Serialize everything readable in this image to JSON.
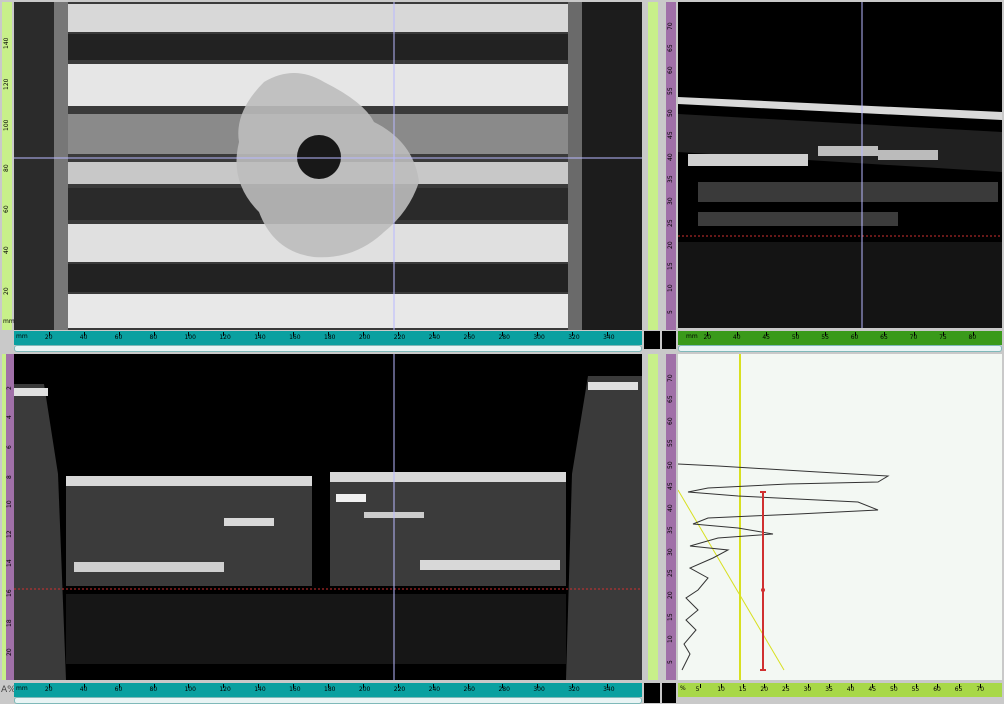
{
  "cscan": {
    "y_axis_label": "mm",
    "x_axis_label": "mm",
    "y_ticks": [
      "20",
      "40",
      "60",
      "80",
      "100",
      "120",
      "140"
    ],
    "x_ticks": [
      "20",
      "40",
      "60",
      "80",
      "100",
      "120",
      "140",
      "160",
      "180",
      "200",
      "220",
      "240",
      "260",
      "280",
      "300",
      "320",
      "340"
    ]
  },
  "sscan": {
    "y_ticks": [
      "2",
      "4",
      "6",
      "8",
      "10",
      "12",
      "14",
      "16",
      "18",
      "20"
    ],
    "y_unit": "mm",
    "x_ticks": [
      "20",
      "40",
      "60",
      "80",
      "100",
      "120",
      "140",
      "160",
      "180",
      "200",
      "220",
      "240",
      "260",
      "280",
      "300",
      "320",
      "340"
    ],
    "x_unit": "mm",
    "corner_label": "A%"
  },
  "bscan": {
    "x_ticks": [
      "20",
      "40",
      "45",
      "50",
      "55",
      "60",
      "65",
      "70",
      "75",
      "80"
    ],
    "x_unit": "mm"
  },
  "ascan": {
    "x_ticks": [
      "5",
      "10",
      "15",
      "20",
      "25",
      "30",
      "35",
      "40",
      "45",
      "50",
      "55",
      "60",
      "65",
      "70"
    ],
    "x_unit": "%"
  },
  "depth_gates": {
    "ticks": [
      "5",
      "10",
      "15",
      "20",
      "25",
      "30",
      "35",
      "40",
      "45",
      "50",
      "55",
      "60",
      "65",
      "70"
    ],
    "unit": "%"
  },
  "colors": {
    "panel_bg": "#000000",
    "ruler_green": "#c8f08a",
    "ruler_purple": "#a070a8",
    "ruler_teal": "#0aa0a0",
    "ruler_green_dark": "#3a9a1a",
    "cursor": "#b8b8ff",
    "gate_red": "#d03030",
    "ascan_bg": "#f3f8f3",
    "gate_yellow": "#d8e020"
  }
}
